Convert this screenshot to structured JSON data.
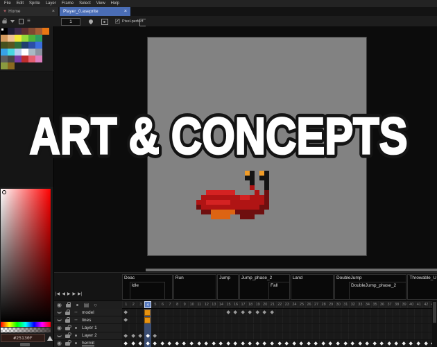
{
  "menu": {
    "items": [
      "File",
      "Edit",
      "Sprite",
      "Layer",
      "Frame",
      "Select",
      "View",
      "Help"
    ]
  },
  "tabs": {
    "home_label": "Home",
    "home_close": "×",
    "active_label": "Player_0.aseprite",
    "active_close": "×"
  },
  "toolbar": {
    "frame_input": "1",
    "pixel_perfect_label": "Pixel-perfect"
  },
  "colors": {
    "active_tab": "#4a6db5",
    "selection_blue": "#5679bf",
    "keyframe_orange": "#e8930f",
    "keyframe_orange_border": "#9a5c06"
  },
  "palette": {
    "rows": [
      [
        "#000000",
        "#1d1d33",
        "#3d2a49",
        "#5d2f2f",
        "#7f4730",
        "#a55d34",
        "#e87614"
      ],
      [
        "#d49a5f",
        "#eec295",
        "#f2e839",
        "#96da3a",
        "#4db33a",
        "#2e9c62"
      ],
      [
        "#45511f",
        "#585520",
        "#2e6e3a",
        "#20406e",
        "#2b4ea6",
        "#3a6ede"
      ],
      [
        "#38a2e6",
        "#47d8e0",
        "#b8cef0",
        "#ffffff",
        "#a8b9c4",
        "#8b93a1"
      ],
      [
        "#5d5d5d",
        "#454545",
        "#7b3da5",
        "#bf2e2e",
        "#e55f70",
        "#dd7fc0"
      ],
      [
        "#8a9b3f",
        "#8a6a1f"
      ]
    ]
  },
  "color_picker": {
    "hex": "#25130F"
  },
  "overlay": {
    "title": "ART & CONCEPTS"
  },
  "timeline": {
    "frames": {
      "count": 43,
      "current": 4
    },
    "playback": [
      "|◀",
      "◀",
      "▶",
      "▶",
      "▶|"
    ],
    "tags": [
      {
        "label": "Deac",
        "start": 1,
        "end": 7,
        "nested": false
      },
      {
        "label": "Idle",
        "start": 2,
        "end": 6,
        "nested": true
      },
      {
        "label": "Run",
        "start": 8,
        "end": 13,
        "nested": false
      },
      {
        "label": "Jump",
        "start": 14,
        "end": 16,
        "nested": false
      },
      {
        "label": "Jump_phase_2",
        "start": 17,
        "end": 23,
        "nested": false
      },
      {
        "label": "Fall",
        "start": 21,
        "end": 23,
        "nested": true
      },
      {
        "label": "Land",
        "start": 24,
        "end": 29,
        "nested": false
      },
      {
        "label": "DoubleJump",
        "start": 30,
        "end": 39,
        "nested": false
      },
      {
        "label": "DoubleJump_phase_2",
        "start": 32,
        "end": 39,
        "nested": true
      },
      {
        "label": "Throwable_U",
        "start": 40,
        "end": 44,
        "nested": false
      }
    ],
    "layers": [
      {
        "name": "model",
        "visible": false,
        "locked": true,
        "linked": true,
        "active": false,
        "dots": [
          1,
          15,
          16,
          17,
          18,
          19,
          20,
          21
        ],
        "orange": [
          4
        ]
      },
      {
        "name": "lines",
        "visible": false,
        "locked": true,
        "linked": true,
        "active": false,
        "dots": [
          1
        ],
        "orange": [
          4
        ]
      },
      {
        "name": "Layer 1",
        "visible": true,
        "locked": false,
        "linked": false,
        "active": false,
        "dots": [],
        "orange": []
      },
      {
        "name": "Layer 2",
        "visible": false,
        "locked": false,
        "linked": false,
        "active": false,
        "dots": [
          1,
          2,
          3,
          4,
          5
        ],
        "orange": []
      },
      {
        "name": "hermit",
        "visible": true,
        "locked": false,
        "linked": false,
        "active": true,
        "dots": "all",
        "orange": []
      }
    ]
  },
  "sprite": {
    "pixel_size": 7,
    "colors": {
      "r": "#b01414",
      "b": "#d42222",
      "d": "#6f0f0f",
      "o": "#dd6412",
      "k": "#141414",
      "y": "#f09c28"
    },
    "rows": [
      "..........yk.yk.",
      "..........kk.kk.",
      "...........k..k.",
      "...........r..k.",
      "..bbbbbb....r.d.",
      ".rrrrrrrrbbrrrd.",
      "rrbbbbbrrrrrrrd.",
      "drrrrrrrrrrrrdd.",
      ".ddooooodddddd..",
      "...oooo..ddd...."
    ]
  }
}
